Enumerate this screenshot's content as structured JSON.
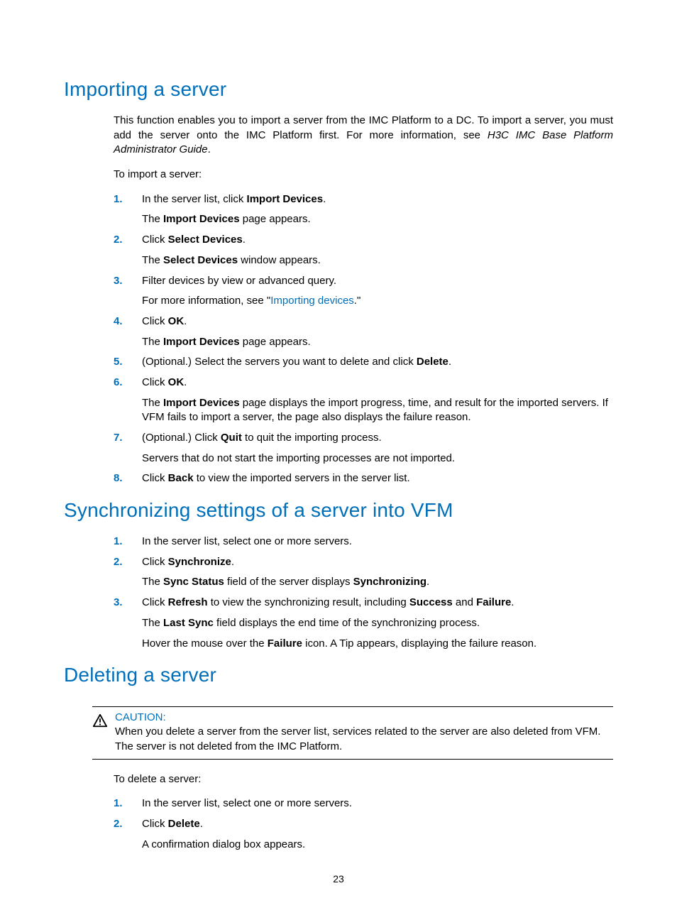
{
  "page_number": "23",
  "sections": {
    "importing": {
      "title": "Importing a server",
      "intro1a": "This function enables you to import a server from the IMC Platform to a DC. To import a server, you must add the server onto the IMC Platform first. For more information, see ",
      "intro1b": "H3C IMC Base Platform Administrator Guide",
      "intro1c": ".",
      "lead": "To import a server:",
      "steps": [
        {
          "pre": "In the server list, click ",
          "bold": "Import Devices",
          "post": ".",
          "sub_pre": "The ",
          "sub_bold": "Import Devices",
          "sub_post": " page appears."
        },
        {
          "pre": "Click ",
          "bold": "Select Devices",
          "post": ".",
          "sub_pre": "The ",
          "sub_bold": "Select Devices",
          "sub_post": " window appears."
        },
        {
          "plain": "Filter devices by view or advanced query.",
          "sub_pre": "For more information, see \"",
          "sub_link": "Importing devices",
          "sub_post": ".\""
        },
        {
          "pre": "Click ",
          "bold": "OK",
          "post": ".",
          "sub_pre": "The ",
          "sub_bold": "Import Devices",
          "sub_post": " page appears."
        },
        {
          "pre": "(Optional.) Select the servers you want to delete and click ",
          "bold": "Delete",
          "post": "."
        },
        {
          "pre": "Click ",
          "bold": "OK",
          "post": ".",
          "sub_pre": "The ",
          "sub_bold": "Import Devices",
          "sub_post": " page displays the import progress, time, and result for the imported servers. If VFM fails to import a server, the page also displays the failure reason."
        },
        {
          "pre": "(Optional.) Click ",
          "bold": "Quit",
          "post": " to quit the importing process.",
          "sub_plain": "Servers that do not start the importing processes are not imported."
        },
        {
          "pre": "Click ",
          "bold": "Back",
          "post": " to view the imported servers in the server list."
        }
      ]
    },
    "sync": {
      "title": "Synchronizing settings of a server into VFM",
      "steps": [
        {
          "plain": "In the server list, select one or more servers."
        },
        {
          "pre": "Click ",
          "bold": "Synchronize",
          "post": ".",
          "sub_pre": "The ",
          "sub_bold": "Sync Status",
          "sub_mid": " field of the server displays ",
          "sub_bold2": "Synchronizing",
          "sub_post": "."
        },
        {
          "pre": "Click ",
          "bold": "Refresh",
          "mid": " to view the synchronizing result, including ",
          "bold2": "Success",
          "mid2": " and ",
          "bold3": "Failure",
          "post": ".",
          "sub_pre": "The ",
          "sub_bold": "Last Sync",
          "sub_post": " field displays the end time of the synchronizing process.",
          "sub2_pre": "Hover the mouse over the ",
          "sub2_bold": "Failure",
          "sub2_post": " icon. A Tip appears, displaying the failure reason."
        }
      ]
    },
    "deleting": {
      "title": "Deleting a server",
      "caution_label": "CAUTION:",
      "caution_text": "When you delete a server from the server list, services related to the server are also deleted from VFM. The server is not deleted from the IMC Platform.",
      "lead": "To delete a server:",
      "steps": [
        {
          "plain": "In the server list, select one or more servers."
        },
        {
          "pre": "Click ",
          "bold": "Delete",
          "post": ".",
          "sub_plain": "A confirmation dialog box appears."
        }
      ]
    }
  }
}
